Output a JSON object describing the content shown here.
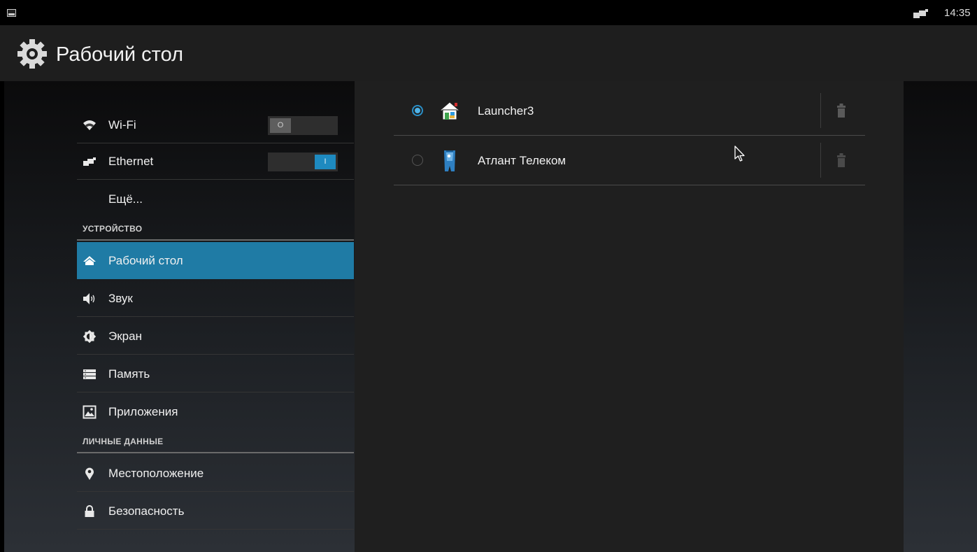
{
  "status_bar": {
    "notification_icon": "screenshot-icon",
    "network_icon": "ethernet-icon",
    "time": "14:35"
  },
  "action_bar": {
    "icon": "gear-icon",
    "title": "Рабочий стол"
  },
  "sidebar": {
    "wifi": {
      "icon": "wifi-icon",
      "label": "Wi-Fi",
      "toggle_text": "O",
      "toggle_state": "off"
    },
    "ethernet": {
      "icon": "ethernet-icon",
      "label": "Ethernet",
      "toggle_text": "I",
      "toggle_state": "on"
    },
    "more": {
      "label": "Ещё..."
    },
    "section_device": "УСТРОЙСТВО",
    "device_items": [
      {
        "icon": "home-icon",
        "label": "Рабочий стол",
        "active": true
      },
      {
        "icon": "sound-icon",
        "label": "Звук"
      },
      {
        "icon": "brightness-icon",
        "label": "Экран"
      },
      {
        "icon": "storage-icon",
        "label": "Память"
      },
      {
        "icon": "apps-icon",
        "label": "Приложения"
      }
    ],
    "section_personal": "ЛИЧНЫЕ ДАННЫЕ",
    "personal_items": [
      {
        "icon": "location-icon",
        "label": "Местоположение"
      },
      {
        "icon": "lock-icon",
        "label": "Безопасность"
      }
    ]
  },
  "launchers": [
    {
      "name": "Launcher3",
      "icon": "launcher3-icon",
      "selected": true,
      "delete_icon": "trash-icon"
    },
    {
      "name": "Атлант Телеком",
      "icon": "atlant-telecom-icon",
      "selected": false,
      "delete_icon": "trash-icon"
    }
  ],
  "colors": {
    "accent": "#1f7ba5",
    "radio_selected": "#4fb3e8",
    "toggle_on": "#1e8ac0"
  }
}
